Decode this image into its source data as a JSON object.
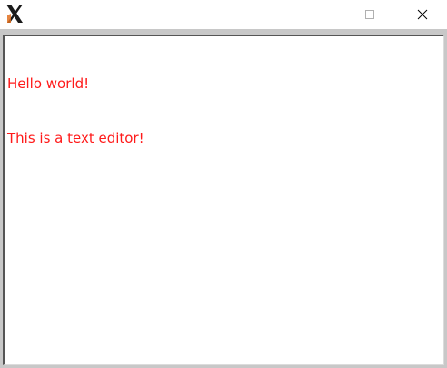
{
  "window": {
    "app_icon": "x-logo-icon",
    "controls": {
      "minimize_icon": "minimize-icon",
      "maximize_icon": "maximize-icon",
      "close_icon": "close-icon"
    }
  },
  "editor": {
    "text_color": "#ff1a1a",
    "lines": [
      "Hello world!",
      "This is a text editor!"
    ]
  }
}
